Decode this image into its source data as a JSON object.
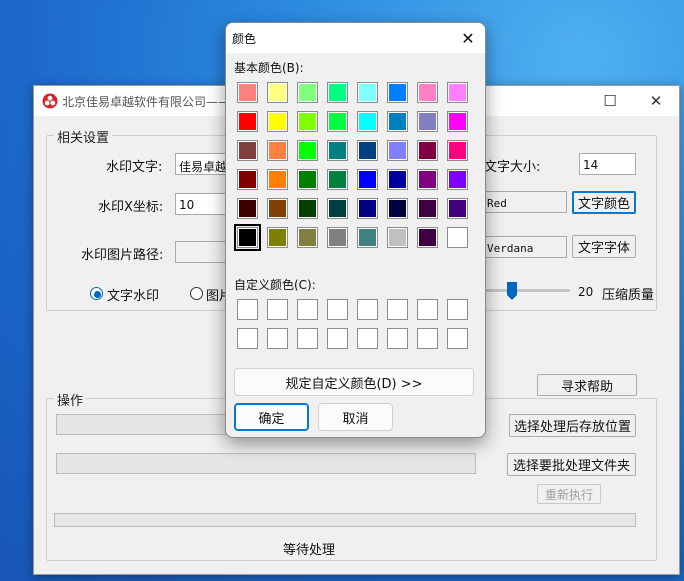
{
  "main_window": {
    "title": "北京佳易卓越软件有限公司——",
    "controls": {
      "minimize": "─",
      "maximize": "☐",
      "close": "✕"
    },
    "settings": {
      "legend": "相关设置",
      "watermark_text_label": "水印文字:",
      "watermark_text_value": "佳易卓越",
      "watermark_x_label": "水印X坐标:",
      "watermark_x_value": "10",
      "image_path_label": "水印图片路径:",
      "image_path_value": "",
      "font_size_label": "文字大小:",
      "font_size_value": "14",
      "color_value": "Red",
      "color_button": "文字颜色",
      "font_value": "Verdana",
      "font_button": "文字字体",
      "quality_value": "20",
      "quality_label": "压缩质量",
      "quality_fraction": 0.14,
      "radio_text": "文字水印",
      "radio_image": "图片"
    },
    "help_button": "寻求帮助",
    "operations": {
      "legend": "操作",
      "choose_output_button": "选择处理后存放位置",
      "choose_folder_button": "选择要批处理文件夹",
      "rerun_button": "重新执行",
      "status": "等待处理"
    }
  },
  "dialog": {
    "title": "颜色",
    "close": "✕",
    "basic_label": "基本颜色(B):",
    "custom_label": "自定义颜色(C):",
    "define_custom_button": "规定自定义颜色(D) >>",
    "ok_button": "确定",
    "cancel_button": "取消",
    "selected_index": 40,
    "basic_colors": [
      "#ff8080",
      "#ffff80",
      "#80ff80",
      "#00ff80",
      "#80ffff",
      "#0080ff",
      "#ff80c0",
      "#ff80ff",
      "#ff0000",
      "#ffff00",
      "#80ff00",
      "#00ff40",
      "#00ffff",
      "#0080c0",
      "#8080c0",
      "#ff00ff",
      "#804040",
      "#ff8040",
      "#00ff00",
      "#008080",
      "#004080",
      "#8080ff",
      "#800040",
      "#ff0080",
      "#800000",
      "#ff8000",
      "#008000",
      "#008040",
      "#0000ff",
      "#0000a0",
      "#800080",
      "#8000ff",
      "#400000",
      "#804000",
      "#004000",
      "#004040",
      "#000080",
      "#000040",
      "#400040",
      "#400080",
      "#000000",
      "#808000",
      "#808040",
      "#808080",
      "#408080",
      "#c0c0c0",
      "#400040",
      "#ffffff"
    ],
    "custom_colors": [
      "#ffffff",
      "#ffffff",
      "#ffffff",
      "#ffffff",
      "#ffffff",
      "#ffffff",
      "#ffffff",
      "#ffffff",
      "#ffffff",
      "#ffffff",
      "#ffffff",
      "#ffffff",
      "#ffffff",
      "#ffffff",
      "#ffffff",
      "#ffffff"
    ]
  }
}
